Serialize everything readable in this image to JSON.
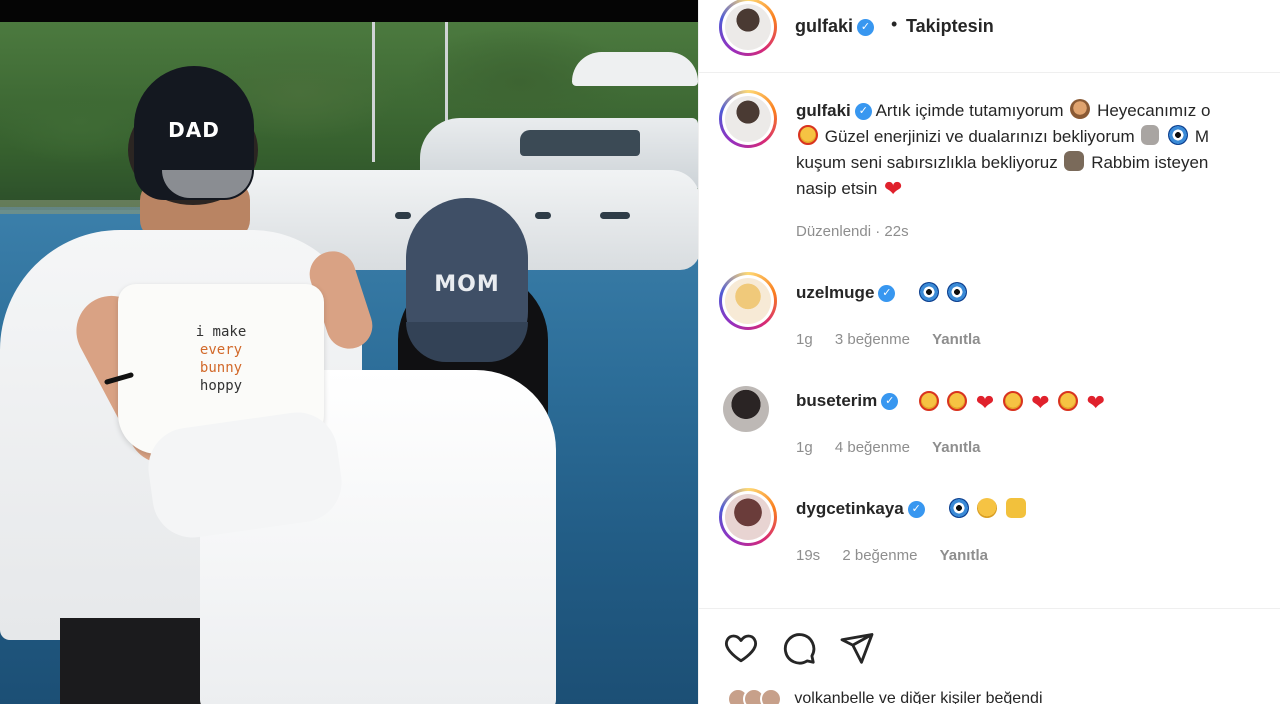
{
  "photo": {
    "cap_dad": "DAD",
    "cap_mom": "MOM",
    "onesie_lines": [
      "i make",
      "every",
      "bunny",
      "hoppy"
    ]
  },
  "header": {
    "username": "gulfaki",
    "separator": "•",
    "follow_status": "Takiptesin"
  },
  "caption": {
    "username": "gulfaki",
    "line1": "Artık içimde tutamıyorum",
    "line1b": "Heyecanımız o",
    "line2": "Güzel enerjinizi ve dualarınızı bekliyorum",
    "line2b": "M",
    "line3": "kuşum seni sabırsızlıkla bekliyoruz",
    "line3b": "Rabbim isteyen",
    "line4": "nasip etsin",
    "meta": "Düzenlendi · 22s"
  },
  "comments": [
    {
      "username": "uzelmuge",
      "emojis": [
        "nazar",
        "nazar"
      ],
      "time": "1g",
      "likes": "3 beğenme",
      "reply": "Yanıtla"
    },
    {
      "username": "buseterim",
      "emojis": [
        "starface",
        "starface",
        "heart",
        "starface",
        "heart",
        "starface",
        "heart"
      ],
      "time": "1g",
      "likes": "4 beğenme",
      "reply": "Yanıtla"
    },
    {
      "username": "dygcetinkaya",
      "emojis": [
        "nazar",
        "smile",
        "hands"
      ],
      "time": "19s",
      "likes": "2 beğenme",
      "reply": "Yanıtla"
    }
  ],
  "actions": {
    "like_icon": "heart-outline-icon",
    "comment_icon": "comment-bubble-icon",
    "share_icon": "paper-plane-icon"
  },
  "likes_row": {
    "text": "volkanbelle ve diğer kişiler beğendi"
  },
  "colors": {
    "verified": "#3897f0",
    "text": "#262626",
    "muted": "#8e8e8e",
    "heart": "#e0212c"
  }
}
